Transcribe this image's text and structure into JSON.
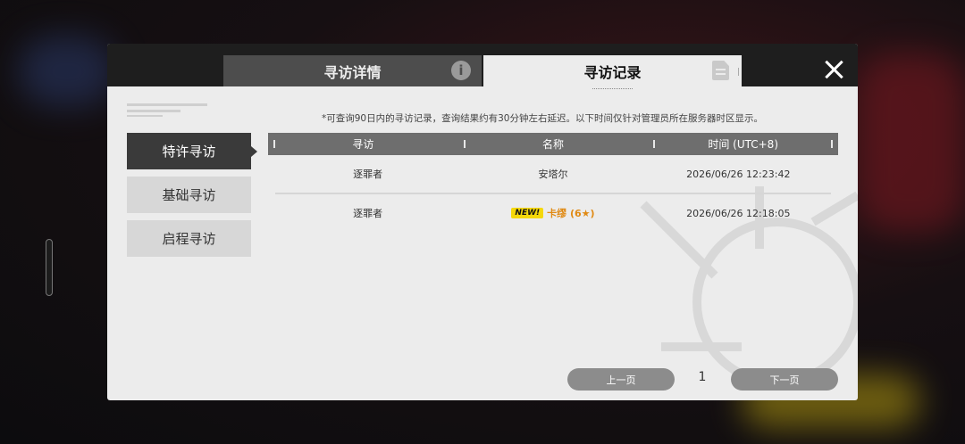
{
  "tabs": [
    {
      "label": "寻访详情",
      "icon": "info-icon"
    },
    {
      "label": "寻访记录",
      "icon": "document-icon"
    }
  ],
  "sidebar": {
    "items": [
      {
        "label": "特许寻访",
        "active": true
      },
      {
        "label": "基础寻访",
        "active": false
      },
      {
        "label": "启程寻访",
        "active": false
      }
    ]
  },
  "notice": "*可查询90日内的寻访记录，查询结果约有30分钟左右延迟。以下时间仅针对管理员所在服务器时区显示。",
  "table": {
    "headers": [
      "寻访",
      "名称",
      "时间 (UTC+8)"
    ],
    "rows": [
      {
        "type": "逐罪者",
        "name": "安塔尔",
        "is_new": false,
        "time": "2026/06/26 12:23:42"
      },
      {
        "type": "逐罪者",
        "new_badge": "NEW!",
        "name": "卡缪 (6★)",
        "is_new": true,
        "time": "2026/06/26 12:18:05"
      }
    ]
  },
  "pagination": {
    "prev_label": "上一页",
    "page": "1",
    "next_label": "下一页"
  },
  "colors": {
    "new_badge": "#f5d80a",
    "new_name": "#e08a14",
    "active_nav": "#3a3a3a"
  }
}
